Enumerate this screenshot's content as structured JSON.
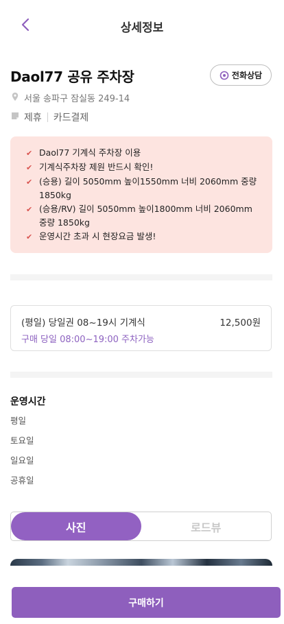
{
  "header": {
    "title": "상세정보"
  },
  "lot": {
    "name": "Daol77 공유 주차장",
    "call_label": "전화상담",
    "address": "서울 송파구 잠실동 249-14",
    "tags": [
      "제휴",
      "카드결제"
    ]
  },
  "notices": [
    "Daol77 기계식 주차장 이용",
    "기계식주차장 제원 반드시 확인!",
    "(승용) 길이 5050mm 높이1550mm 너비 2060mm 중량 1850kg",
    "(승용/RV) 길이 5050mm 높이1800mm 너비 2060mm 중량 1850kg",
    "운영시간 초과 시 현장요금 발생!"
  ],
  "ticket": {
    "name": "(평일) 당일권 08~19시 기계식",
    "price": "12,500원",
    "condition": "구매 당일 08:00~19:00 주차가능"
  },
  "hours": {
    "title": "운영시간",
    "days": [
      "평일",
      "토요일",
      "일요일",
      "공휴일"
    ]
  },
  "tabs": [
    "사진",
    "로드뷰"
  ],
  "buy_label": "구매하기",
  "colors": {
    "accent": "#8e5fbd",
    "notice_bg": "#fde4e0",
    "check": "#d9534f"
  }
}
